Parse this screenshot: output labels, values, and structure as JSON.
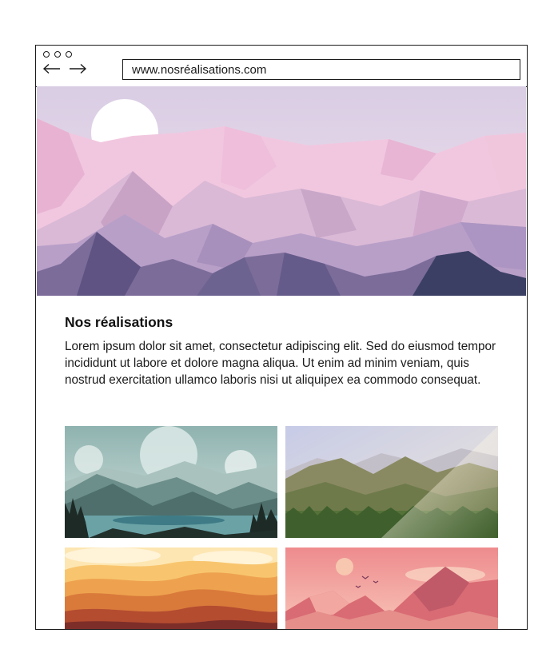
{
  "window": {
    "controls": [
      "dot-1",
      "dot-2",
      "dot-3"
    ],
    "back_icon": "arrow-left-icon",
    "forward_icon": "arrow-right-icon"
  },
  "address_bar": {
    "url": "www.nosréalisations.com"
  },
  "hero": {
    "image": "pink-mountain-landscape-with-sun"
  },
  "section": {
    "title": "Nos réalisations",
    "body": "Lorem ipsum dolor sit amet, consectetur adipiscing elit. Sed do eiusmod tempor incididunt ut labore et dolore magna aliqua. Ut enim ad minim veniam, quis nostrud exercitation ullamco laboris nisi ut aliquipex ea commodo consequat."
  },
  "gallery": {
    "items": [
      {
        "image": "misty-teal-mountains-with-lake"
      },
      {
        "image": "sunlit-green-valley"
      },
      {
        "image": "orange-desert-hills"
      },
      {
        "image": "pink-peaks-with-birds"
      }
    ]
  },
  "colors": {
    "border": "#1a1a1a",
    "text": "#111111",
    "background": "#ffffff"
  }
}
